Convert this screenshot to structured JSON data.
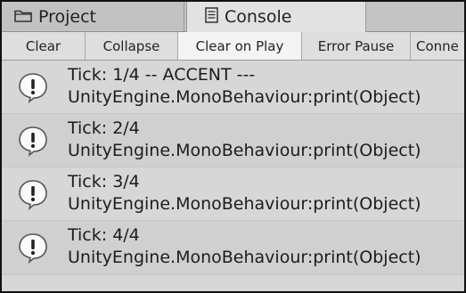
{
  "tabs": [
    {
      "label": "Project",
      "icon": "folder-icon",
      "active": false
    },
    {
      "label": "Console",
      "icon": "console-icon",
      "active": true
    }
  ],
  "toolbar": {
    "clear": "Clear",
    "collapse": "Collapse",
    "clear_on_play": "Clear on Play",
    "error_pause": "Error Pause",
    "connect": "Conne"
  },
  "logs": [
    {
      "line1": "Tick: 1/4 -- ACCENT ---",
      "line2": "UnityEngine.MonoBehaviour:print(Object)",
      "icon": "info-icon"
    },
    {
      "line1": "Tick: 2/4",
      "line2": "UnityEngine.MonoBehaviour:print(Object)",
      "icon": "info-icon"
    },
    {
      "line1": "Tick: 3/4",
      "line2": "UnityEngine.MonoBehaviour:print(Object)",
      "icon": "info-icon"
    },
    {
      "line1": "Tick: 4/4",
      "line2": "UnityEngine.MonoBehaviour:print(Object)",
      "icon": "info-icon"
    }
  ],
  "colors": {
    "panel": "#d7d7d7",
    "toolbar": "#e4e4e4",
    "active_toggle": "#f4f4f4",
    "text": "#1c1c1c"
  }
}
